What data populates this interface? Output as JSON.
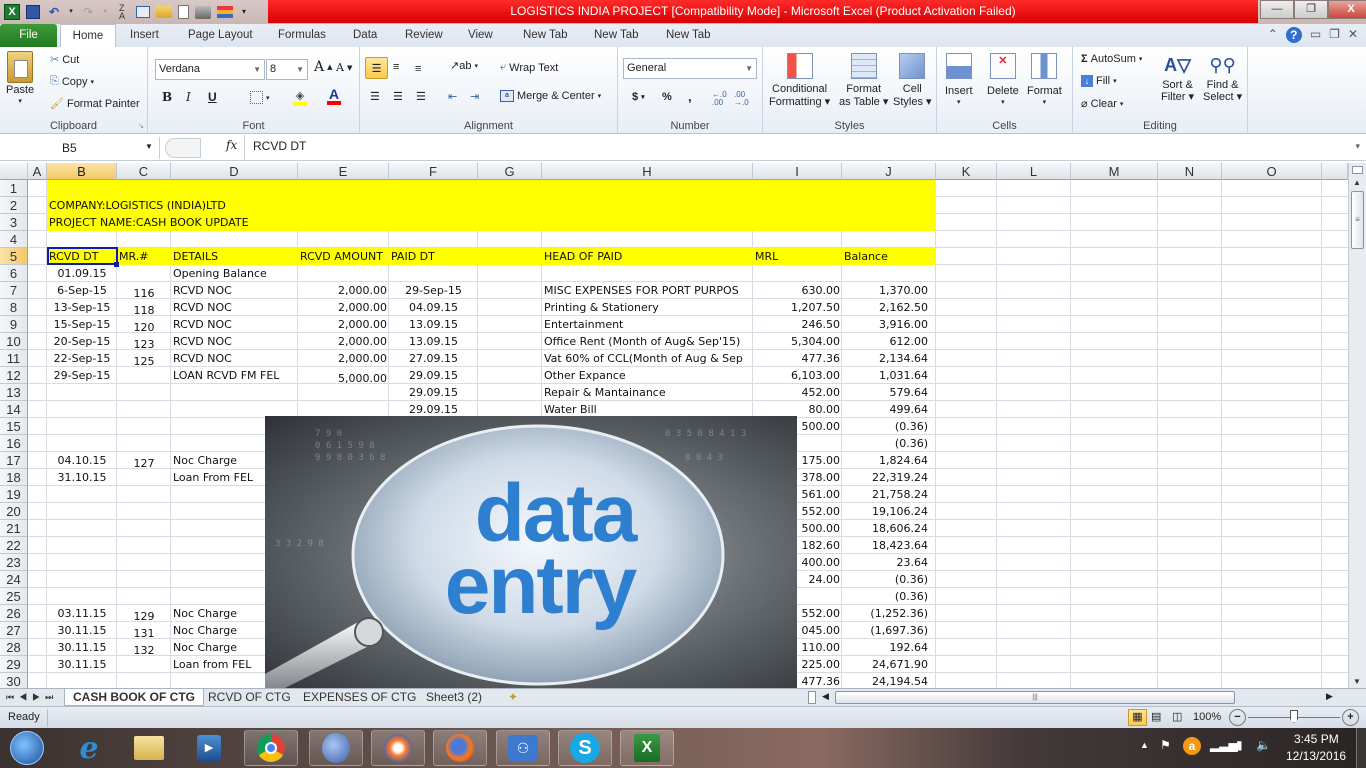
{
  "window": {
    "title": "LOGISTICS INDIA PROJECT  [Compatibility Mode]  -  Microsoft Excel (Product Activation Failed)",
    "controls": {
      "minimize": "—",
      "restore": "❐",
      "close": "X"
    }
  },
  "quick_access": [
    "excel-logo",
    "save",
    "undo",
    "redo",
    "sort",
    "form",
    "open",
    "new",
    "print-preview",
    "chart",
    "customize"
  ],
  "ribbon_tabs": [
    "File",
    "Home",
    "Insert",
    "Page Layout",
    "Formulas",
    "Data",
    "Review",
    "View",
    "New Tab",
    "New Tab",
    "New Tab"
  ],
  "active_tab": "Home",
  "ribbon": {
    "clipboard": {
      "label": "Clipboard",
      "paste": "Paste",
      "cut": "Cut",
      "copy": "Copy",
      "format_painter": "Format Painter"
    },
    "font": {
      "label": "Font",
      "name": "Verdana",
      "size": "8",
      "bold": "B",
      "italic": "I",
      "underline": "U",
      "fill_color": "#ffff00",
      "font_color": "#ff0000"
    },
    "alignment": {
      "label": "Alignment",
      "wrap_text": "Wrap Text",
      "merge_center": "Merge & Center"
    },
    "number": {
      "label": "Number",
      "format": "General",
      "currency": "$",
      "percent": "%",
      "comma": ",",
      "inc_decimal": ".00 ←.0",
      "dec_decimal": ".00 →.0"
    },
    "styles": {
      "label": "Styles",
      "conditional": [
        "Conditional",
        "Formatting"
      ],
      "format_table": [
        "Format",
        "as Table"
      ],
      "cell_styles": [
        "Cell",
        "Styles"
      ]
    },
    "cells": {
      "label": "Cells",
      "insert": "Insert",
      "delete": "Delete",
      "format": "Format"
    },
    "editing": {
      "label": "Editing",
      "autosum": "AutoSum",
      "fill": "Fill",
      "clear": "Clear",
      "sort_filter": [
        "Sort &",
        "Filter"
      ],
      "find_select": [
        "Find &",
        "Select"
      ]
    }
  },
  "formula_bar": {
    "name_box": "B5",
    "fx": "fx",
    "value": "RCVD DT"
  },
  "columns": [
    "A",
    "B",
    "C",
    "D",
    "E",
    "F",
    "G",
    "H",
    "I",
    "J",
    "K",
    "L",
    "M",
    "N",
    "O"
  ],
  "selected_column": "B",
  "selected_row": 5,
  "rows": [
    1,
    2,
    3,
    4,
    5,
    6,
    7,
    8,
    9,
    10,
    11,
    12,
    13,
    14,
    15,
    16,
    17,
    18,
    19,
    20,
    21,
    22,
    23,
    24,
    25,
    26,
    27,
    28,
    29,
    30
  ],
  "sheet": {
    "company": "COMPANY:LOGISTICS (INDIA)LTD",
    "project": "PROJECT NAME:CASH BOOK  UPDATE",
    "headers": {
      "B": "RCVD DT",
      "C": "MR.#",
      "D": "DETAILS",
      "E": "RCVD AMOUNT",
      "F": "PAID DT",
      "H": "HEAD OF PAID",
      "I": "MRL",
      "J": "Balance"
    },
    "highlight_color": "#ffff00",
    "data_rows": [
      {
        "row": 6,
        "B": "01.09.15",
        "C": "",
        "D": "Opening Balance",
        "E": "",
        "F": "",
        "H": "",
        "I": "",
        "J": ""
      },
      {
        "row": 7,
        "B": "6-Sep-15",
        "C": "116",
        "D": "RCVD NOC",
        "E": "2,000.00",
        "F": "29-Sep-15",
        "H": "MISC EXPENSES FOR PORT PURPOS",
        "I": "630.00",
        "J": "1,370.00"
      },
      {
        "row": 8,
        "B": "13-Sep-15",
        "C": "118",
        "D": "RCVD NOC",
        "E": "2,000.00",
        "F": "04.09.15",
        "H": "Printing & Stationery",
        "I": "1,207.50",
        "J": "2,162.50"
      },
      {
        "row": 9,
        "B": "15-Sep-15",
        "C": "120",
        "D": "RCVD NOC",
        "E": "2,000.00",
        "F": "13.09.15",
        "H": "Entertainment",
        "I": "246.50",
        "J": "3,916.00"
      },
      {
        "row": 10,
        "B": "20-Sep-15",
        "C": "123",
        "D": "RCVD NOC",
        "E": "2,000.00",
        "F": "13.09.15",
        "H": "Office Rent (Month of Aug& Sep'15)",
        "I": "5,304.00",
        "J": "612.00"
      },
      {
        "row": 11,
        "B": "22-Sep-15",
        "C": "125",
        "D": "RCVD NOC",
        "E": "2,000.00",
        "F": "27.09.15",
        "H": "Vat 60% of CCL(Month of Aug & Sep",
        "I": "477.36",
        "J": "2,134.64"
      },
      {
        "row": 12,
        "B": "29-Sep-15",
        "C": "",
        "D": "LOAN RCVD FM FEL",
        "E": "5,000.00",
        "F": "29.09.15",
        "H": "Other Expance",
        "I": "6,103.00",
        "J": "1,031.64"
      },
      {
        "row": 13,
        "B": "",
        "C": "",
        "D": "",
        "E": "",
        "F": "29.09.15",
        "H": "Repair & Mantainance",
        "I": "452.00",
        "J": "579.64"
      },
      {
        "row": 14,
        "B": "",
        "C": "",
        "D": "",
        "E": "",
        "F": "29.09.15",
        "H": "Water Bill",
        "I": "80.00",
        "J": "499.64"
      },
      {
        "row": 15,
        "B": "",
        "C": "",
        "D": "",
        "E": "",
        "F": "",
        "H": "",
        "I": "500.00",
        "J": "(0.36)"
      },
      {
        "row": 16,
        "B": "",
        "C": "",
        "D": "",
        "E": "",
        "F": "",
        "H": "",
        "I": "",
        "J": "(0.36)"
      },
      {
        "row": 17,
        "B": "04.10.15",
        "C": "127",
        "D": "Noc Charge",
        "E": "",
        "F": "",
        "H": "",
        "I": "175.00",
        "J": "1,824.64"
      },
      {
        "row": 18,
        "B": "31.10.15",
        "C": "",
        "D": "Loan From FEL",
        "E": "",
        "F": "",
        "H": "",
        "I": "378.00",
        "J": "22,319.24"
      },
      {
        "row": 19,
        "B": "",
        "C": "",
        "D": "",
        "E": "",
        "F": "",
        "H": "",
        "I": "561.00",
        "J": "21,758.24"
      },
      {
        "row": 20,
        "B": "",
        "C": "",
        "D": "",
        "E": "",
        "F": "",
        "H": "",
        "I": "552.00",
        "J": "19,106.24"
      },
      {
        "row": 21,
        "B": "",
        "C": "",
        "D": "",
        "E": "",
        "F": "",
        "H": "",
        "I": "500.00",
        "J": "18,606.24"
      },
      {
        "row": 22,
        "B": "",
        "C": "",
        "D": "",
        "E": "",
        "F": "",
        "H": "",
        "I": "182.60",
        "J": "18,423.64"
      },
      {
        "row": 23,
        "B": "",
        "C": "",
        "D": "",
        "E": "",
        "F": "",
        "H": "",
        "I": "400.00",
        "J": "23.64"
      },
      {
        "row": 24,
        "B": "",
        "C": "",
        "D": "",
        "E": "",
        "F": "",
        "H": "",
        "I": "24.00",
        "J": "(0.36)"
      },
      {
        "row": 25,
        "B": "",
        "C": "",
        "D": "",
        "E": "",
        "F": "",
        "H": "",
        "I": "",
        "J": "(0.36)"
      },
      {
        "row": 26,
        "B": "03.11.15",
        "C": "129",
        "D": "Noc Charge",
        "E": "",
        "F": "",
        "H": "",
        "I": "552.00",
        "J": "(1,252.36)"
      },
      {
        "row": 27,
        "B": "30.11.15",
        "C": "131",
        "D": "Noc Charge",
        "E": "",
        "F": "",
        "H": "",
        "I": "045.00",
        "J": "(1,697.36)"
      },
      {
        "row": 28,
        "B": "30.11.15",
        "C": "132",
        "D": "Noc Charge",
        "E": "",
        "F": "",
        "H": "",
        "I": "110.00",
        "J": "192.64"
      },
      {
        "row": 29,
        "B": "30.11.15",
        "C": "",
        "D": "Loan from FEL",
        "E": "",
        "F": "",
        "H": "",
        "I": "225.00",
        "J": "24,671.90"
      },
      {
        "row": 30,
        "B": "",
        "C": "",
        "D": "",
        "E": "",
        "F": "",
        "H": "",
        "I": "477.36",
        "J": "24,194.54"
      }
    ]
  },
  "overlay_picture": {
    "line1": "data",
    "line2": "entry",
    "text_color": "#2f7fd0"
  },
  "sheet_tabs": [
    "CASH BOOK OF CTG",
    "RCVD OF CTG",
    "EXPENSES OF CTG",
    "Sheet3 (2)"
  ],
  "active_sheet": "CASH BOOK OF CTG",
  "status_bar": {
    "mode": "Ready",
    "zoom": "100%"
  },
  "zoom_level_percent": 100,
  "taskbar": {
    "apps": [
      "start",
      "internet-explorer",
      "file-explorer",
      "media-player",
      "chrome",
      "moon-app",
      "firefox-alt",
      "firefox",
      "people-hub",
      "skype",
      "excel"
    ],
    "time": "3:45 PM",
    "date": "12/13/2016"
  }
}
